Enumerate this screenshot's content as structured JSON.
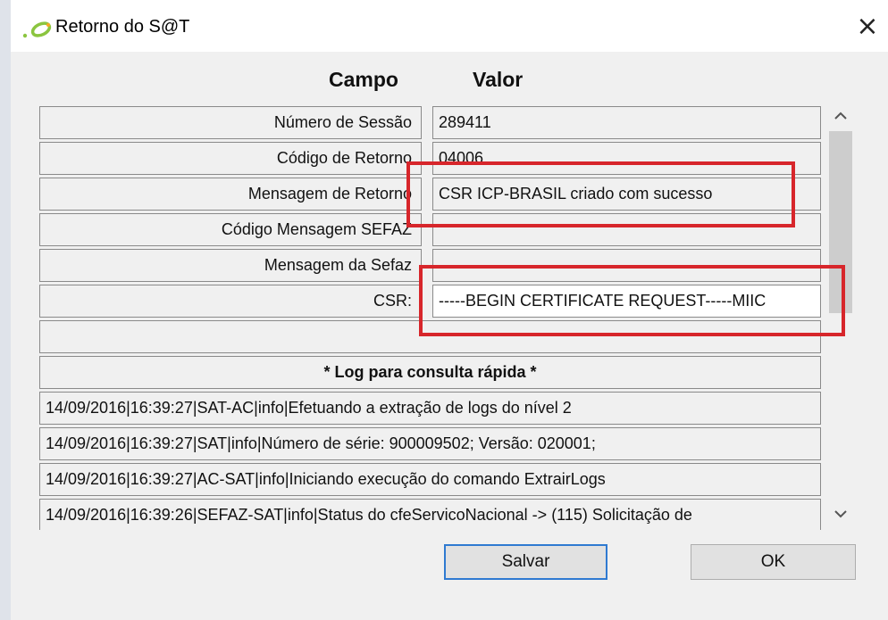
{
  "window": {
    "title": "Retorno do S@T",
    "close_glyph": "×",
    "icon": "sat-app-icon"
  },
  "table": {
    "header_field": "Campo",
    "header_value": "Valor",
    "rows": [
      {
        "field": "Número de Sessão",
        "value": "289411"
      },
      {
        "field": "Código de Retorno",
        "value": "04006"
      },
      {
        "field": "Mensagem de Retorno",
        "value": "CSR ICP-BRASIL criado com sucesso"
      },
      {
        "field": "Código Mensagem SEFAZ",
        "value": ""
      },
      {
        "field": "Mensagem da Sefaz",
        "value": ""
      },
      {
        "field": "CSR:",
        "value": "-----BEGIN CERTIFICATE REQUEST-----MIIC"
      }
    ],
    "log_title": "* Log para consulta rápida *",
    "log_lines": [
      "14/09/2016|16:39:27|SAT-AC|info|Efetuando a extração de logs do nível 2",
      "14/09/2016|16:39:27|SAT|info|Número de série: 900009502; Versão: 020001;",
      "14/09/2016|16:39:27|AC-SAT|info|Iniciando execução do comando ExtrairLogs",
      "14/09/2016|16:39:26|SEFAZ-SAT|info|Status do cfeServicoNacional -> (115) Solicitação de"
    ]
  },
  "scrollbar": {
    "up_glyph": "^",
    "down_glyph": "v"
  },
  "buttons": {
    "save": "Salvar",
    "ok": "OK"
  },
  "colors": {
    "highlight": "#d7262b",
    "focus_border": "#2f7ad1"
  }
}
